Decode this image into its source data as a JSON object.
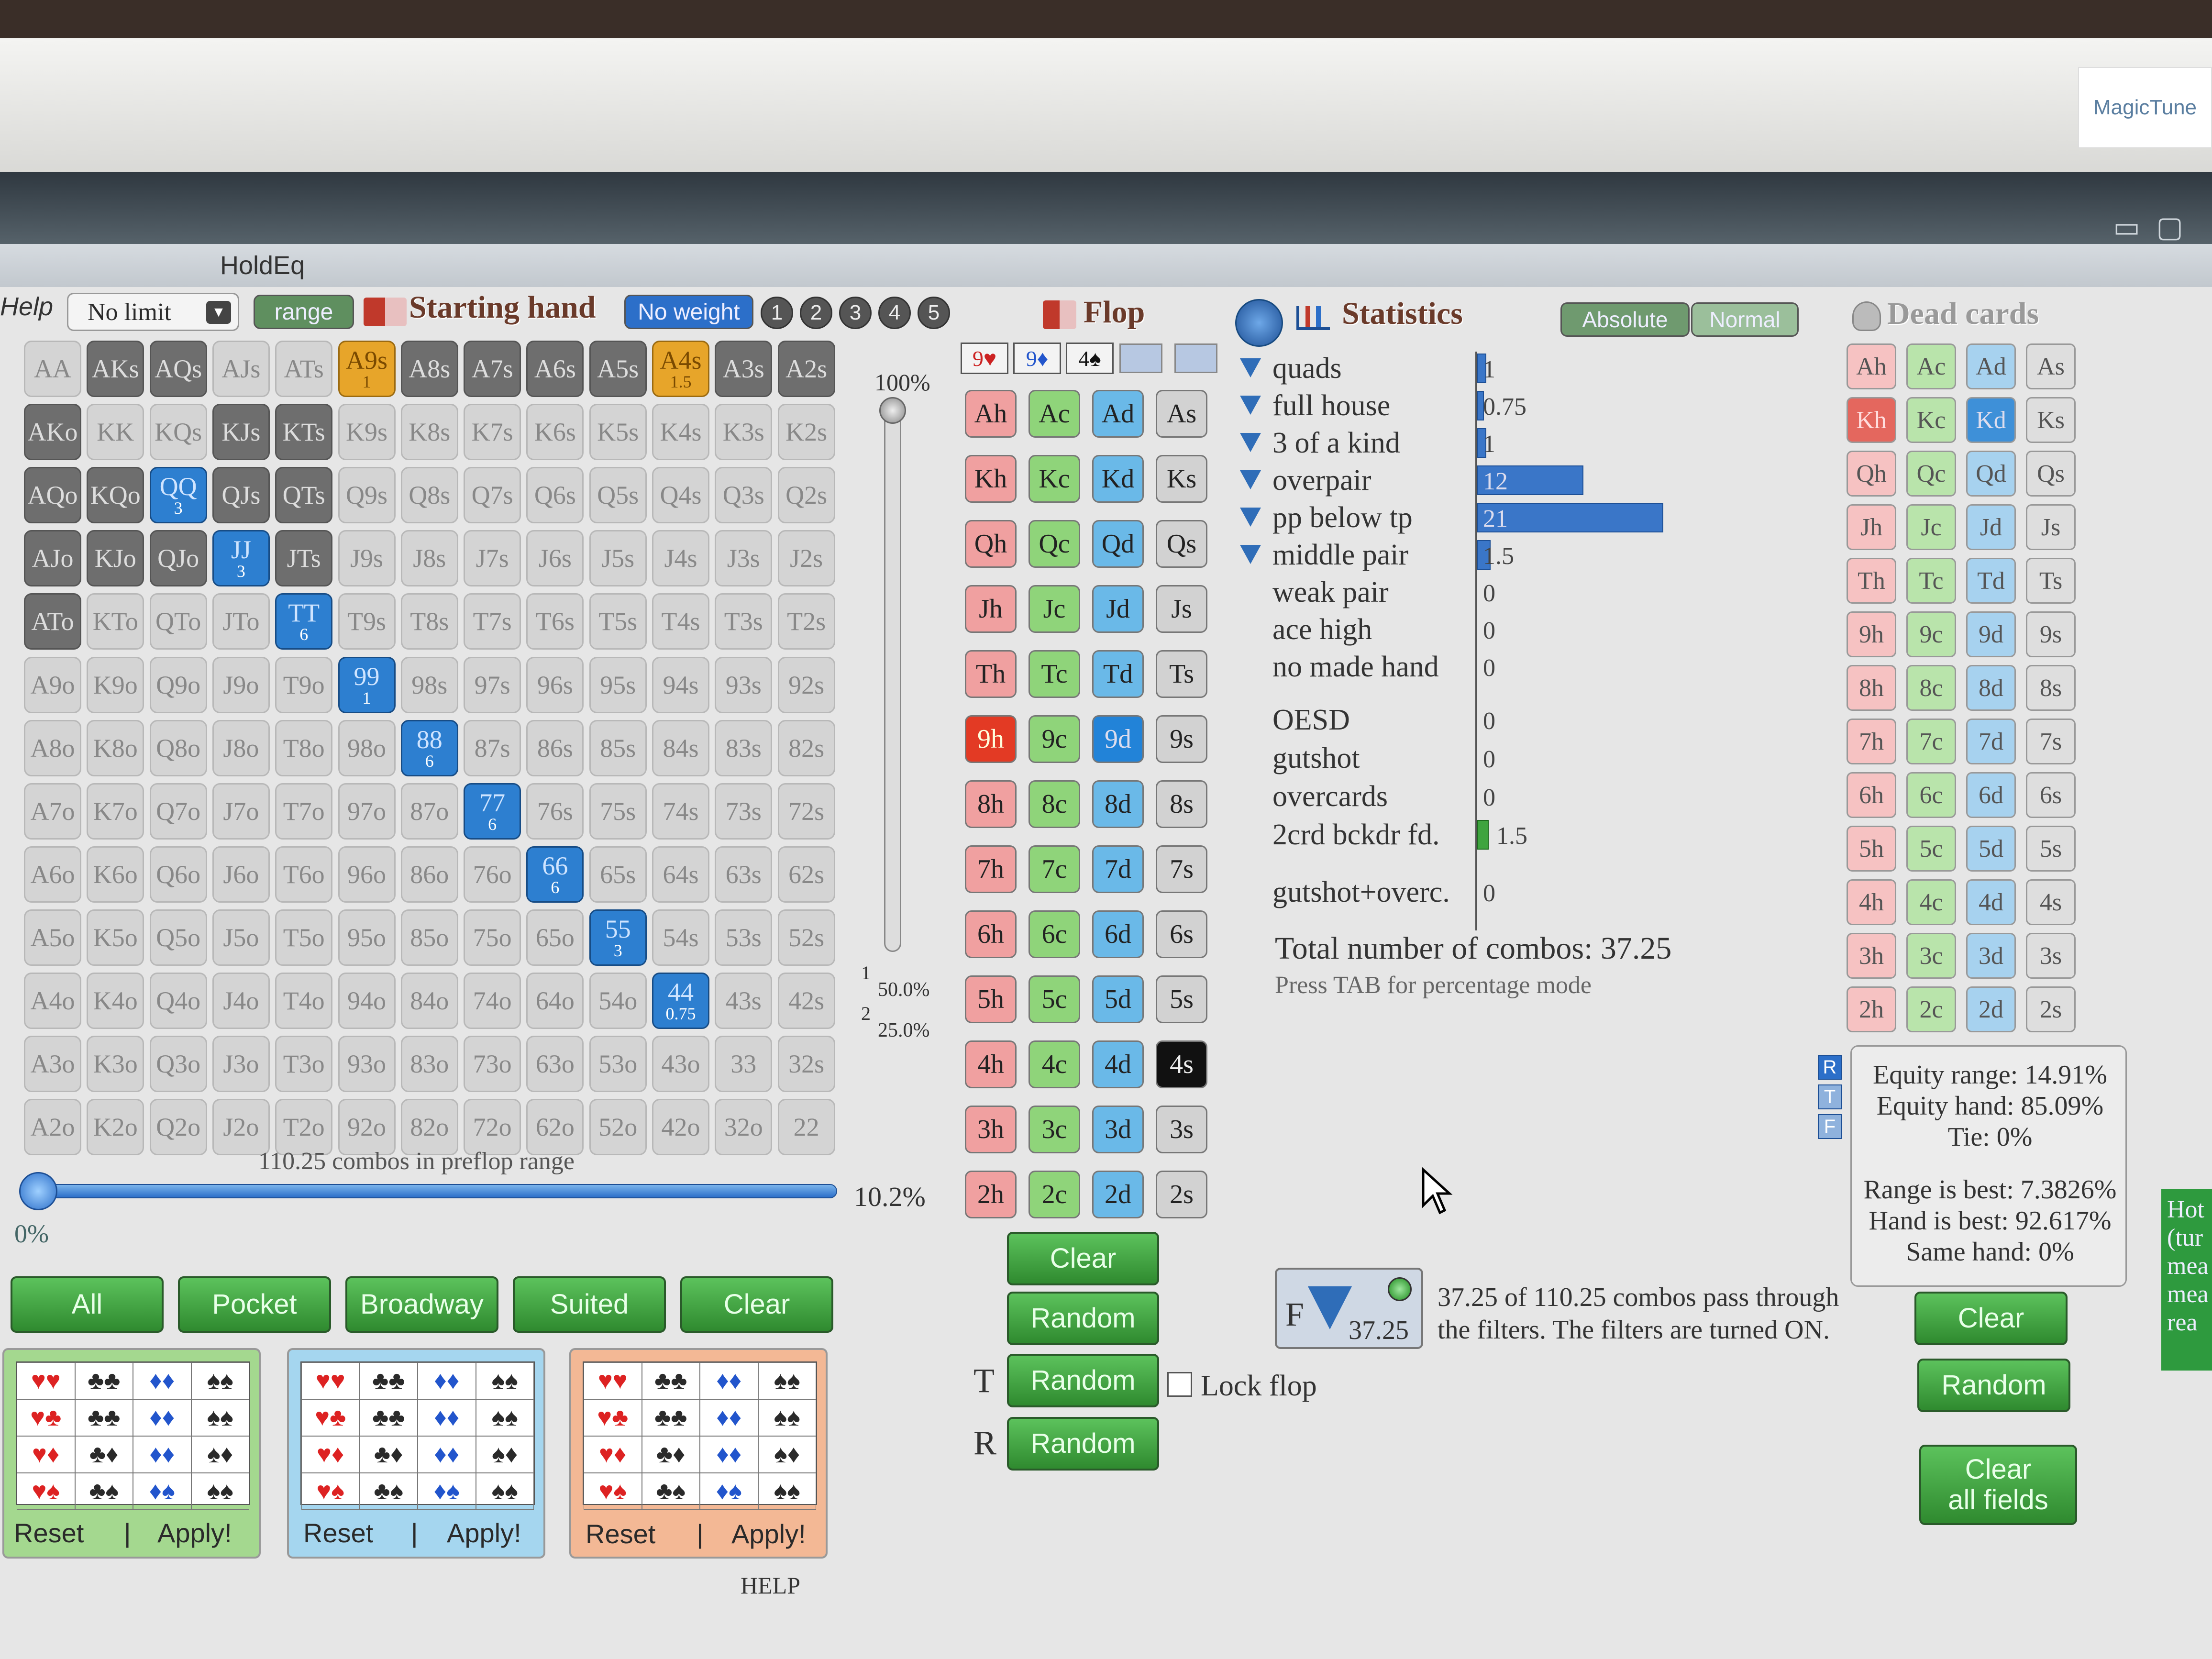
{
  "brand": "MagicTune",
  "app_title": "HoldEq",
  "menu": {
    "help": "Help"
  },
  "limit_select": "No limit",
  "range_button": "range",
  "section_starting_hand": "Starting hand",
  "weight_button": "No weight",
  "weight_numbers": [
    "1",
    "2",
    "3",
    "4",
    "5"
  ],
  "hand_grid": [
    [
      "AA",
      "AKs",
      "AQs",
      "AJs",
      "ATs",
      "A9s",
      "A8s",
      "A7s",
      "A6s",
      "A5s",
      "A4s",
      "A3s",
      "A2s"
    ],
    [
      "AKo",
      "KK",
      "KQs",
      "KJs",
      "KTs",
      "K9s",
      "K8s",
      "K7s",
      "K6s",
      "K5s",
      "K4s",
      "K3s",
      "K2s"
    ],
    [
      "AQo",
      "KQo",
      "QQ",
      "QJs",
      "QTs",
      "Q9s",
      "Q8s",
      "Q7s",
      "Q6s",
      "Q5s",
      "Q4s",
      "Q3s",
      "Q2s"
    ],
    [
      "AJo",
      "KJo",
      "QJo",
      "JJ",
      "JTs",
      "J9s",
      "J8s",
      "J7s",
      "J6s",
      "J5s",
      "J4s",
      "J3s",
      "J2s"
    ],
    [
      "ATo",
      "KTo",
      "QTo",
      "JTo",
      "TT",
      "T9s",
      "T8s",
      "T7s",
      "T6s",
      "T5s",
      "T4s",
      "T3s",
      "T2s"
    ],
    [
      "A9o",
      "K9o",
      "Q9o",
      "J9o",
      "T9o",
      "99",
      "98s",
      "97s",
      "96s",
      "95s",
      "94s",
      "93s",
      "92s"
    ],
    [
      "A8o",
      "K8o",
      "Q8o",
      "J8o",
      "T8o",
      "98o",
      "88",
      "87s",
      "86s",
      "85s",
      "84s",
      "83s",
      "82s"
    ],
    [
      "A7o",
      "K7o",
      "Q7o",
      "J7o",
      "T7o",
      "97o",
      "87o",
      "77",
      "76s",
      "75s",
      "74s",
      "73s",
      "72s"
    ],
    [
      "A6o",
      "K6o",
      "Q6o",
      "J6o",
      "T6o",
      "96o",
      "86o",
      "76o",
      "66",
      "65s",
      "64s",
      "63s",
      "62s"
    ],
    [
      "A5o",
      "K5o",
      "Q5o",
      "J5o",
      "T5o",
      "95o",
      "85o",
      "75o",
      "65o",
      "55",
      "54s",
      "53s",
      "52s"
    ],
    [
      "A4o",
      "K4o",
      "Q4o",
      "J4o",
      "T4o",
      "94o",
      "84o",
      "74o",
      "64o",
      "54o",
      "44",
      "43s",
      "42s"
    ],
    [
      "A3o",
      "K3o",
      "Q3o",
      "J3o",
      "T3o",
      "93o",
      "83o",
      "73o",
      "63o",
      "53o",
      "43o",
      "33",
      "32s"
    ],
    [
      "A2o",
      "K2o",
      "Q2o",
      "J2o",
      "T2o",
      "92o",
      "82o",
      "72o",
      "62o",
      "52o",
      "42o",
      "32o",
      "22"
    ]
  ],
  "selected_hands": {
    "QQ": "3",
    "JJ": "3",
    "TT": "6",
    "99": "1",
    "88": "6",
    "77": "6",
    "66": "6",
    "55": "3",
    "44": "0.75"
  },
  "gold_hands": {
    "A9s": "1",
    "A4s": "1.5"
  },
  "dark_hands": [
    "AKo",
    "AQo",
    "KQo",
    "AJo",
    "KJo",
    "QJo",
    "ATo",
    "KTs",
    "KJs",
    "QJs",
    "QTs",
    "JTs",
    "AQs",
    "AKs",
    "A8s",
    "A7s",
    "A6s",
    "A5s",
    "A3s",
    "A2s"
  ],
  "preflop_combos": "110.25 combos in preflop range",
  "slider_min": "0%",
  "slider_value": "10.2%",
  "vslider_top": "100%",
  "vslider_mid1": "50.0%",
  "vslider_mid2": "25.0%",
  "vslider_m1": "1",
  "vslider_m2": "2",
  "quick_buttons": [
    "All",
    "Pocket",
    "Broadway",
    "Suited",
    "Clear"
  ],
  "presets": [
    {
      "reset": "Reset",
      "sep": "|",
      "apply": "Apply!"
    },
    {
      "reset": "Reset",
      "sep": "|",
      "apply": "Apply!"
    },
    {
      "reset": "Reset",
      "sep": "|",
      "apply": "Apply!"
    }
  ],
  "help_link": "HELP",
  "section_flop": "Flop",
  "flop_slots": [
    "9♥",
    "9♦",
    "4♠"
  ],
  "flop_ranks": [
    "A",
    "K",
    "Q",
    "J",
    "T",
    "9",
    "8",
    "7",
    "6",
    "5",
    "4",
    "3",
    "2"
  ],
  "flop_selected": [
    "9h",
    "9d",
    "4s"
  ],
  "flop_clear": "Clear",
  "flop_random": "Random",
  "turn_label": "T",
  "turn_random": "Random",
  "river_label": "R",
  "river_random": "Random",
  "lock_flop": "Lock flop",
  "section_statistics": "Statistics",
  "mode_absolute": "Absolute",
  "mode_normal": "Normal",
  "stats": [
    {
      "label": "quads",
      "value": "1",
      "n": 1,
      "filter": true
    },
    {
      "label": "full house",
      "value": "0.75",
      "n": 0.75,
      "filter": true
    },
    {
      "label": "3 of a kind",
      "value": "1",
      "n": 1,
      "filter": true
    },
    {
      "label": "overpair",
      "value": "12",
      "n": 12,
      "filter": true
    },
    {
      "label": "pp below tp",
      "value": "21",
      "n": 21,
      "filter": true
    },
    {
      "label": "middle pair",
      "value": "1.5",
      "n": 1.5,
      "filter": true
    },
    {
      "label": "weak pair",
      "value": "0",
      "n": 0,
      "filter": false
    },
    {
      "label": "ace high",
      "value": "0",
      "n": 0,
      "filter": false
    },
    {
      "label": "no made hand",
      "value": "0",
      "n": 0,
      "filter": false
    }
  ],
  "draws": [
    {
      "label": "OESD",
      "value": "0",
      "n": 0
    },
    {
      "label": "gutshot",
      "value": "0",
      "n": 0
    },
    {
      "label": "overcards",
      "value": "0",
      "n": 0
    },
    {
      "label": "2crd bckdr fd.",
      "value": "1.5",
      "n": 1.5
    }
  ],
  "combo_draw": {
    "label": "gutshot+overc.",
    "value": "0"
  },
  "total_combos": "Total number of combos: 37.25",
  "tab_hint": "Press TAB for percentage mode",
  "filter_box": {
    "letter": "F",
    "value": "37.25"
  },
  "filter_text_1": "37.25 of 110.25 combos pass through",
  "filter_text_2": "the filters. The filters are turned ON.",
  "section_dead": "Dead cards",
  "dead_selected": [
    "Kh",
    "Kd"
  ],
  "rtf": [
    "R",
    "T",
    "F"
  ],
  "equity": {
    "range": "Equity range: 14.91%",
    "hand": "Equity hand: 85.09%",
    "tie": "Tie: 0%",
    "range_best": "Range is best: 7.3826%",
    "hand_best": "Hand is best: 92.617%",
    "same": "Same hand: 0%"
  },
  "dead_clear": "Clear",
  "dead_random": "Random",
  "clear_all_1": "Clear",
  "clear_all_2": "all fields",
  "side_note": [
    "Hot",
    "(tur",
    "mea",
    "mea",
    "rea"
  ],
  "colors": {
    "selected": "#2d7fd0",
    "gold": "#e7a52a",
    "green_button": "#3fa43f",
    "bar": "#3a76c8"
  }
}
